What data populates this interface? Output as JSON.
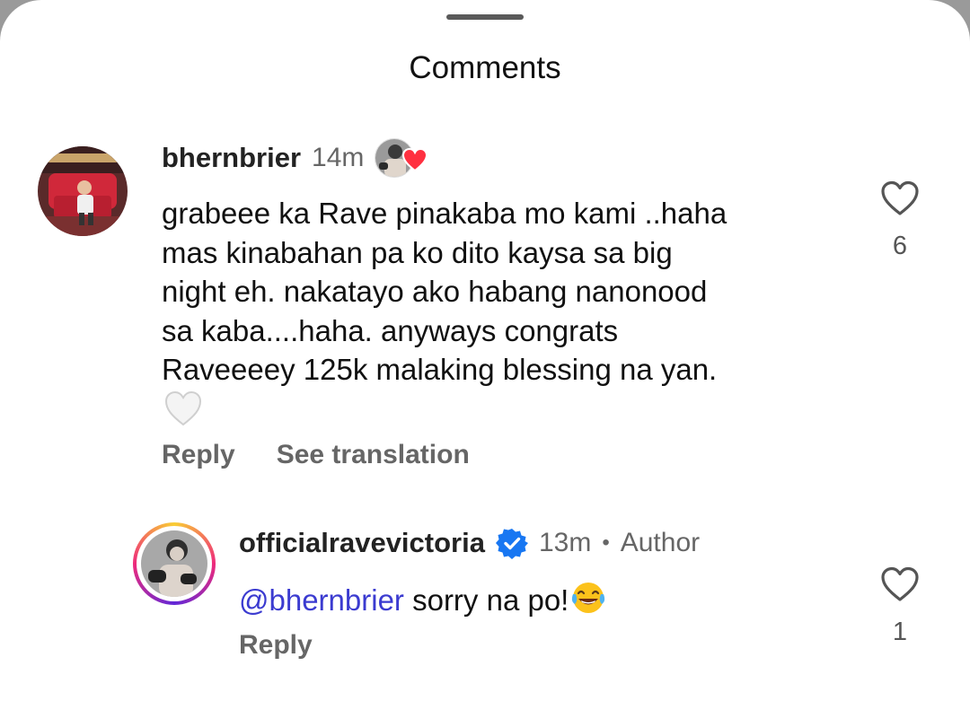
{
  "sheet": {
    "title": "Comments"
  },
  "comments": [
    {
      "username": "bhernbrier",
      "time": "14m",
      "text_lines": [
        "grabeee ka Rave pinakaba mo kami ..haha",
        "mas kinabahan pa ko dito kaysa sa big",
        "night eh. nakatayo ako habang nanonood",
        "sa kaba....haha. anyways congrats",
        "Raveeeey 125k malaking blessing na yan."
      ],
      "trailing_emoji": "white-heart-emoji",
      "reply_label": "Reply",
      "see_translation_label": "See translation",
      "like_count": "6",
      "liked_by_author": true
    },
    {
      "username": "officialravevictoria",
      "verified": true,
      "time": "13m",
      "separator": "•",
      "role_label": "Author",
      "mention": "@bhernbrier",
      "text": "sorry na po!",
      "trailing_emoji": "face-with-tears-of-joy-emoji",
      "reply_label": "Reply",
      "like_count": "1"
    }
  ],
  "colors": {
    "mention": "#3b3bd0",
    "verified": "#1877f2",
    "heart_red": "#ff3040",
    "muted_text": "#666666"
  }
}
